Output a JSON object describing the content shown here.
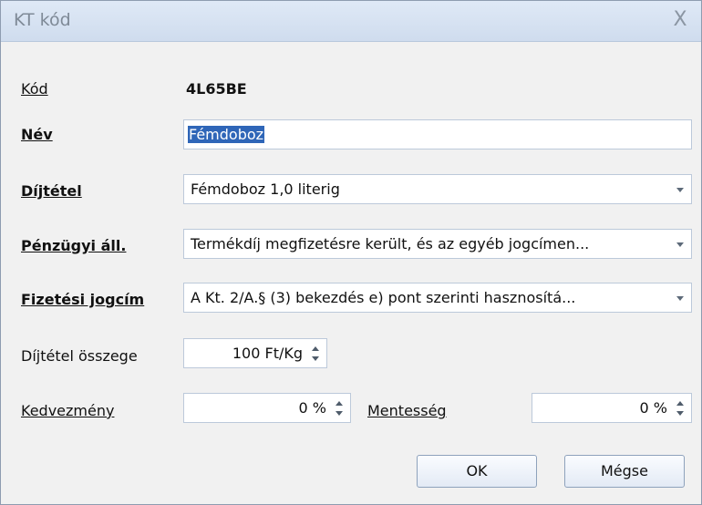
{
  "window": {
    "title": "KT kód",
    "close_symbol": "X"
  },
  "fields": {
    "code": {
      "label": "Kód",
      "value": "4L65BE"
    },
    "name": {
      "label": "Név",
      "value": "Fémdoboz"
    },
    "rate": {
      "label": "Díjtétel",
      "value": "Fémdoboz 1,0 literig"
    },
    "financial_status": {
      "label": "Pénzügyi áll.",
      "value": "Termékdíj megfizetésre került, és az egyéb jogcímen..."
    },
    "payment_basis": {
      "label": "Fizetési jogcím",
      "value": "A Kt. 2/A.§ (3) bekezdés e) pont szerinti  hasznosítá..."
    },
    "rate_amount": {
      "label": "Díjtétel összege",
      "value": "100 Ft/Kg"
    },
    "discount": {
      "label": "Kedvezmény",
      "value": "0 %"
    },
    "exemption": {
      "label": "Mentesség",
      "value": "0 %"
    }
  },
  "buttons": {
    "ok": "OK",
    "cancel": "Mégse"
  }
}
